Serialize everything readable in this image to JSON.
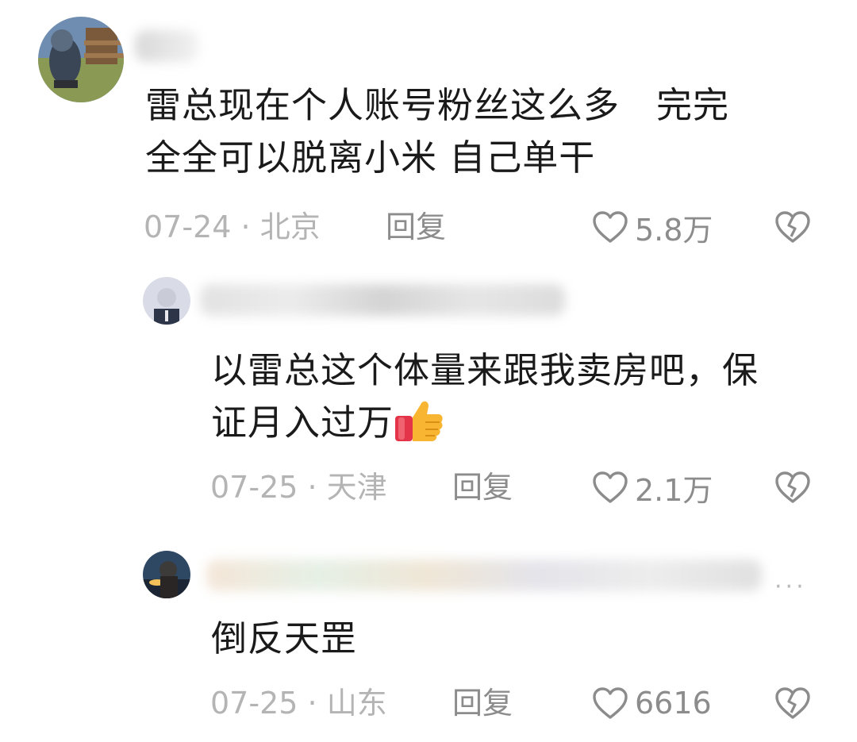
{
  "comments": [
    {
      "text_lines": [
        "雷总现在个人账号粉丝这么多　完完",
        "全全可以脱离小米  自己单干"
      ],
      "date": "07-24",
      "location": "北京",
      "reply_label": "回复",
      "likes": "5.8万"
    },
    {
      "text_lines": [
        "以雷总这个体量来跟我卖房吧，保",
        "证月入过万"
      ],
      "emoji": "thumbs-up",
      "date": "07-25",
      "location": "天津",
      "reply_label": "回复",
      "likes": "2.1万"
    },
    {
      "text_lines": [
        "倒反天罡"
      ],
      "date": "07-25",
      "location": "山东",
      "reply_label": "回复",
      "likes": "6616"
    }
  ],
  "separator": "·",
  "more_label": "···",
  "icons": [
    "heart-outline-icon",
    "broken-heart-icon",
    "thumbs-up-emoji",
    "more-icon"
  ]
}
